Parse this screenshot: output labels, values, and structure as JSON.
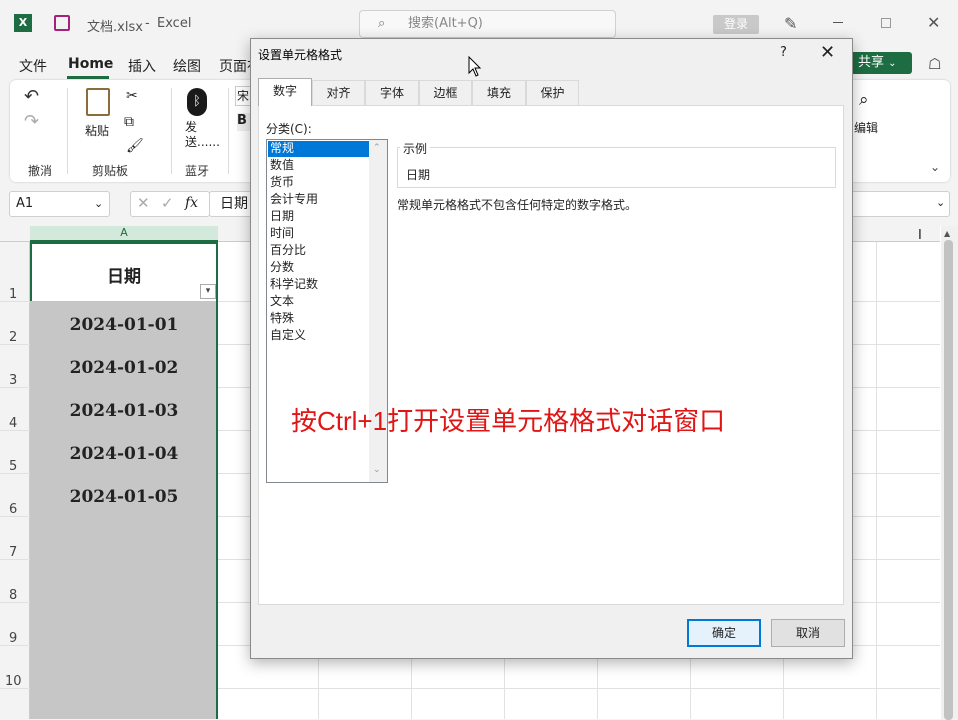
{
  "titlebar": {
    "filename": "文档.xlsx",
    "separator": "-",
    "app": "Excel",
    "search_placeholder": "搜索(Alt+Q)",
    "login": "登录"
  },
  "menu": {
    "file": "文件",
    "home": "Home",
    "insert": "插入",
    "draw": "绘图",
    "layout": "页面布",
    "share": "共享"
  },
  "ribbon": {
    "undo_group": "撤消",
    "paste": "粘贴",
    "clipboard_group": "剪贴板",
    "bt_send": "发送......",
    "bluetooth_group": "蓝牙",
    "edit": "编辑",
    "font_partial": "宋"
  },
  "formula_bar": {
    "name_box": "A1",
    "fx": "fx",
    "formula_value": "日期"
  },
  "sheet": {
    "col_a": "A",
    "rows": [
      "1",
      "2",
      "3",
      "4",
      "5",
      "6",
      "7",
      "8",
      "9",
      "10"
    ],
    "header": "日期",
    "dates": [
      "2024-01-01",
      "2024-01-02",
      "2024-01-03",
      "2024-01-04",
      "2024-01-05"
    ]
  },
  "dialog": {
    "title": "设置单元格格式",
    "help": "?",
    "close": "✕",
    "tabs": [
      "数字",
      "对齐",
      "字体",
      "边框",
      "填充",
      "保护"
    ],
    "category_label": "分类(C):",
    "categories": [
      "常规",
      "数值",
      "货币",
      "会计专用",
      "日期",
      "时间",
      "百分比",
      "分数",
      "科学记数",
      "文本",
      "特殊",
      "自定义"
    ],
    "selected_category": "常规",
    "sample_label": "示例",
    "sample_value": "日期",
    "description": "常规单元格格式不包含任何特定的数字格式。",
    "ok": "确定",
    "cancel": "取消"
  },
  "annotation": "按Ctrl+1打开设置单元格格式对话窗口",
  "colors": {
    "excel_green": "#1e6c41",
    "selection_blue": "#0078d7",
    "annotation_red": "#e01515"
  }
}
